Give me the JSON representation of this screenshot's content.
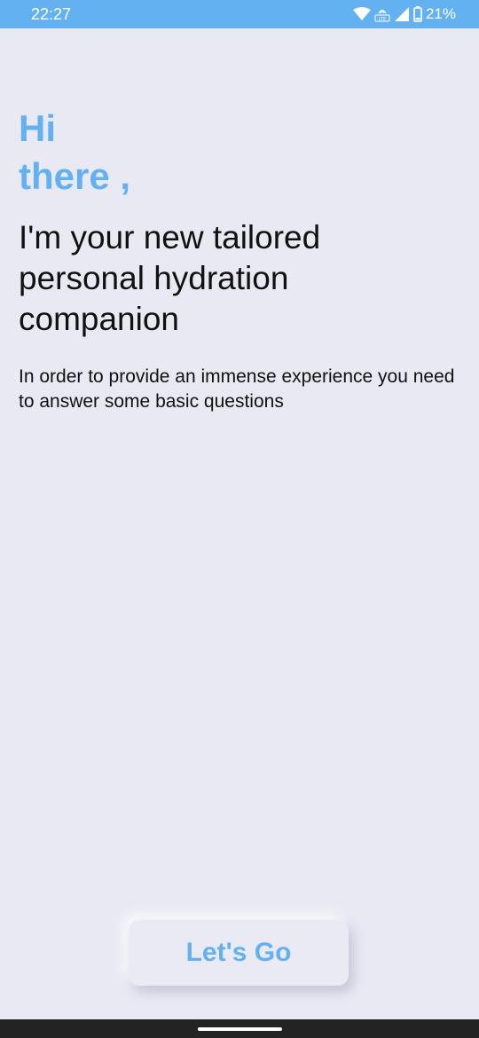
{
  "status_bar": {
    "time": "22:27",
    "network_badge": "LTE",
    "battery_percent": "21%",
    "icons": [
      "wifi-icon",
      "volte-icon",
      "signal-icon",
      "battery-icon"
    ]
  },
  "greeting": {
    "line1": "Hi",
    "line2": "there ,"
  },
  "headline": "I'm your new tailored personal hydration companion",
  "description": "In order to provide an immense experience you need to answer some basic questions",
  "cta": {
    "label": "Let's Go"
  },
  "colors": {
    "accent": "#63b1f0",
    "background": "#e8e9f3",
    "text": "#111111",
    "nav_bar": "#232323"
  }
}
